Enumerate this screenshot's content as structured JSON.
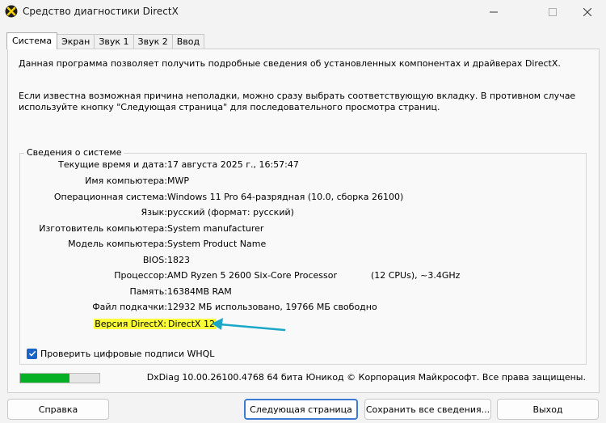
{
  "window": {
    "title": "Средство диагностики DirectX",
    "app_icon": "directx-x-icon"
  },
  "tabs": [
    {
      "label": "Система",
      "active": true
    },
    {
      "label": "Экран",
      "active": false
    },
    {
      "label": "Звук 1",
      "active": false
    },
    {
      "label": "Звук 2",
      "active": false
    },
    {
      "label": "Ввод",
      "active": false
    }
  ],
  "intro": {
    "line1": "Данная программа позволяет получить подробные сведения об установленных компонентах и драйверах DirectX.",
    "line2": "Если известна возможная причина неполадки, можно сразу выбрать соответствующую вкладку. В противном случае используйте кнопку \"Следующая страница\" для последовательного просмотра страниц."
  },
  "system_info": {
    "group_title": "Сведения о системе",
    "rows": [
      {
        "label": "Текущие время и дата:",
        "value": "17 августа 2025 г., 16:57:47"
      },
      {
        "label": "Имя компьютера:",
        "value": "MWP"
      },
      {
        "label": "Операционная система:",
        "value": "Windows 11 Pro 64-разрядная (10.0, сборка 26100)"
      },
      {
        "label": "Язык:",
        "value": "русский (формат: русский)"
      },
      {
        "label": "Изготовитель компьютера:",
        "value": "System manufacturer"
      },
      {
        "label": "Модель компьютера:",
        "value": "System Product Name"
      },
      {
        "label": "BIOS:",
        "value": "1823"
      },
      {
        "label": "Процессор:",
        "value": "AMD Ryzen 5 2600 Six-Core Processor            (12 CPUs), ~3.4GHz"
      },
      {
        "label": "Память:",
        "value": "16384MB RAM"
      },
      {
        "label": "Файл подкачки:",
        "value": "12932 МБ использовано, 19766 МБ свободно"
      },
      {
        "label": "Версия DirectX:",
        "value": "DirectX 12",
        "highlight": true
      }
    ]
  },
  "whql_checkbox": {
    "label": "Проверить цифровые подписи WHQL",
    "checked": true
  },
  "progress": {
    "fraction": 0.62,
    "color": "#06b025"
  },
  "status_text": "DxDiag 10.00.26100.4768 64 бита Юникод © Корпорация Майкрософт. Все права защищены.",
  "buttons": {
    "help": "Справка",
    "next_page": "Следующая страница",
    "save_all": "Сохранить все сведения...",
    "exit": "Выход"
  },
  "colors": {
    "highlight": "#fbff3a",
    "annotation_arrow": "#1ba6c8",
    "accent": "#3d7bd2"
  }
}
